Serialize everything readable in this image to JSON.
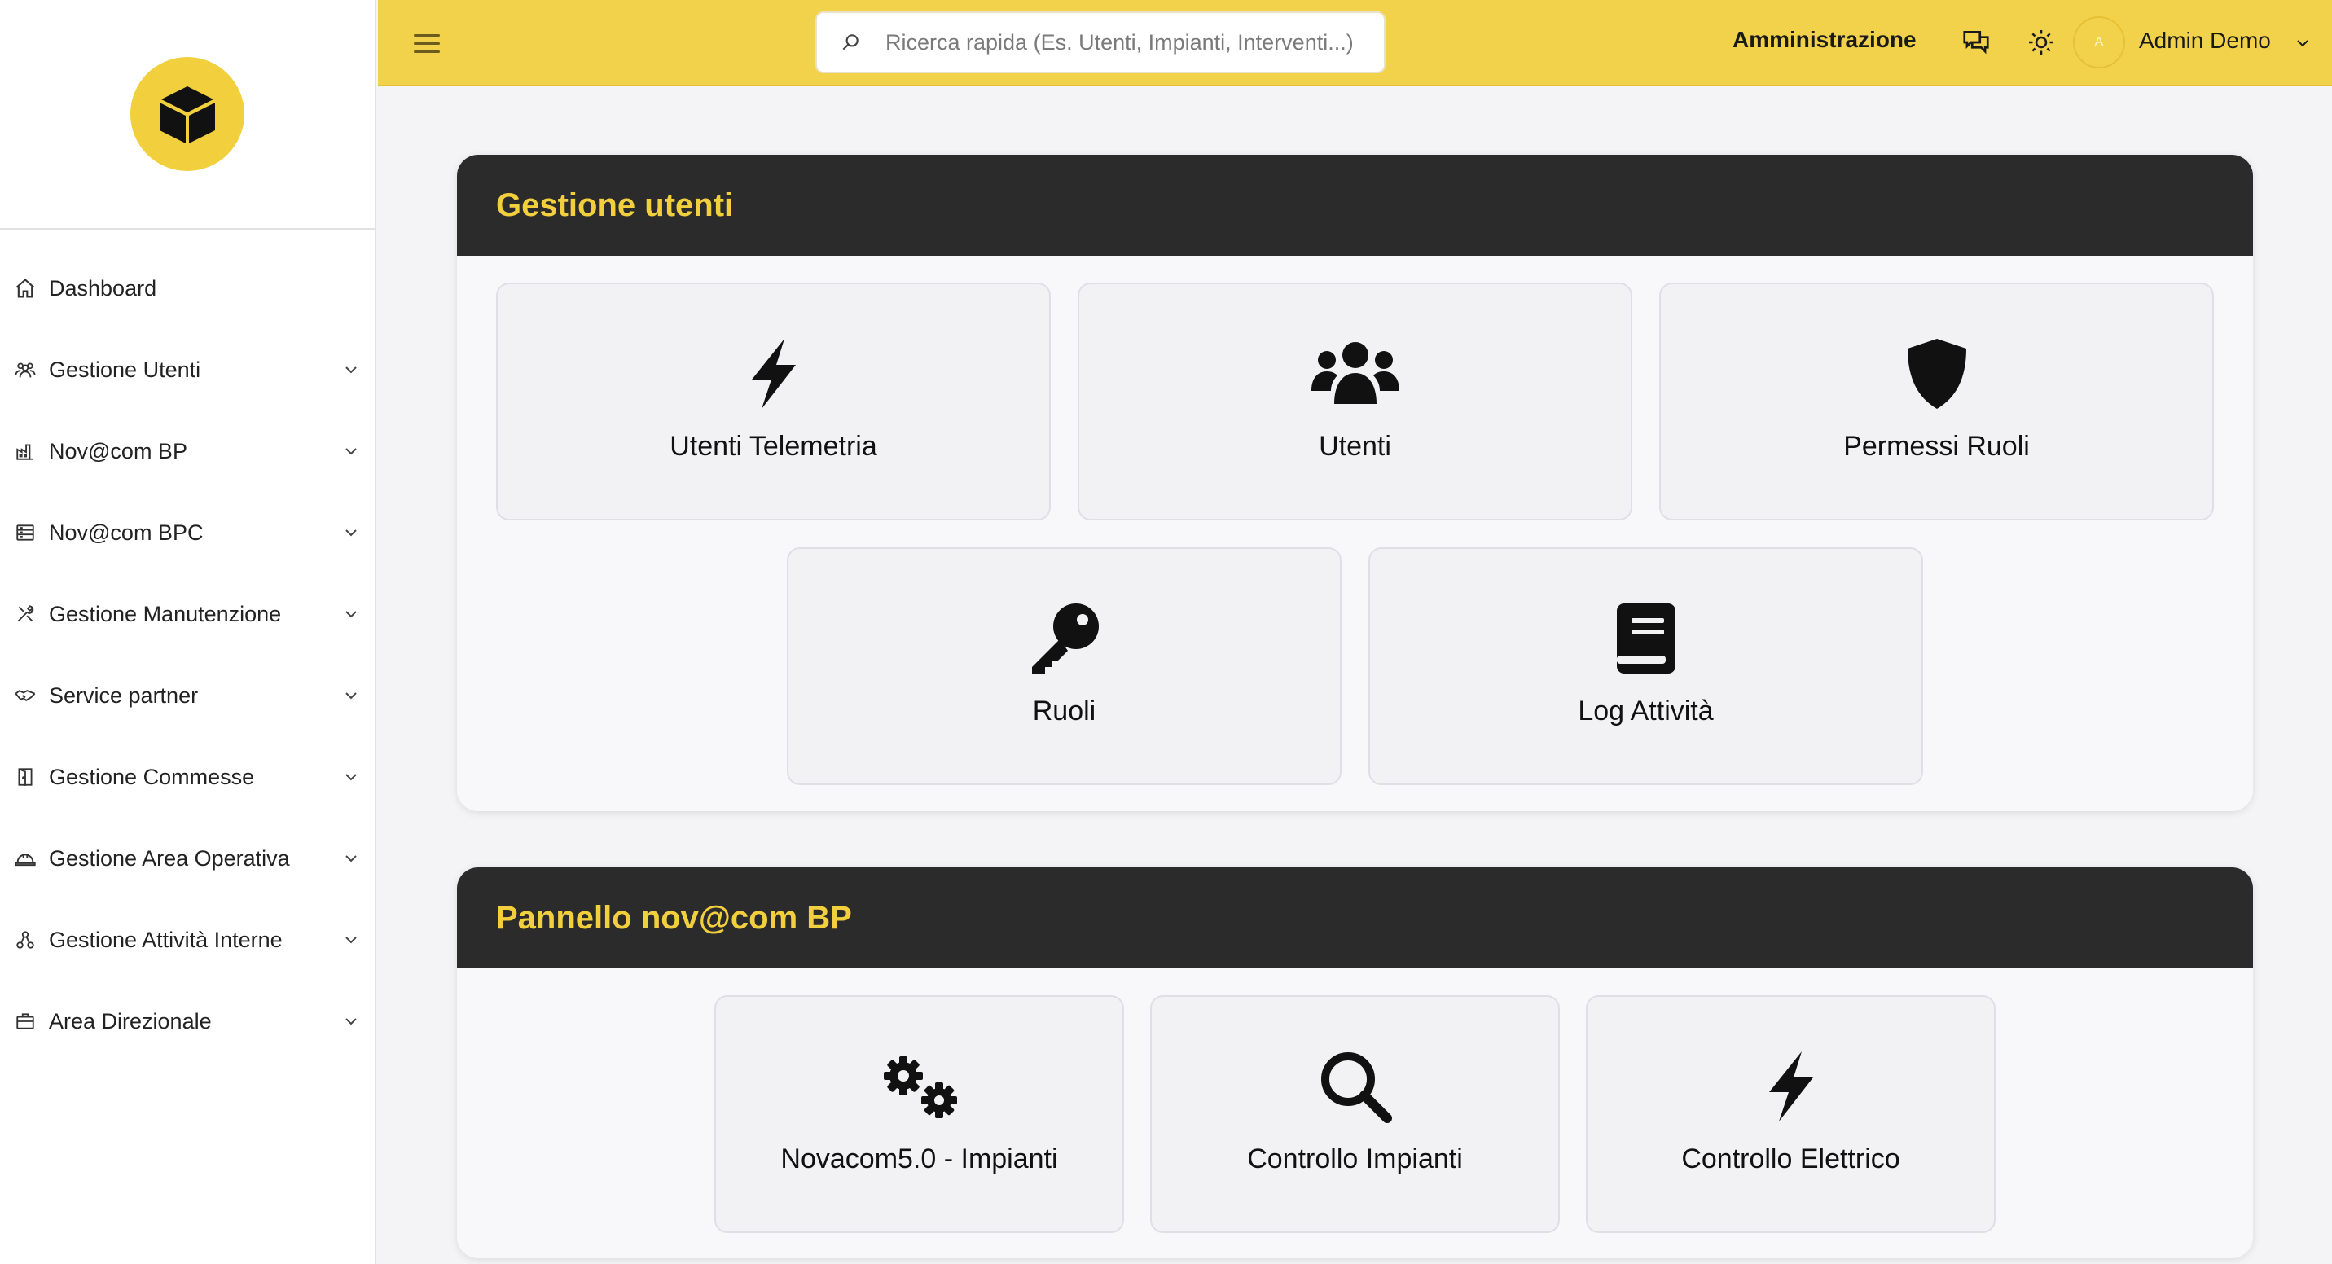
{
  "brand": {
    "logo_icon": "cube-icon",
    "accent_color": "#f2cf3c",
    "dark_color": "#2b2b2b"
  },
  "sidebar": {
    "items": [
      {
        "label": "Dashboard",
        "icon": "home-icon",
        "has_children": false
      },
      {
        "label": "Gestione Utenti",
        "icon": "users-icon",
        "has_children": true
      },
      {
        "label": "Nov@com BP",
        "icon": "factory-icon",
        "has_children": true
      },
      {
        "label": "Nov@com BPC",
        "icon": "server-icon",
        "has_children": true
      },
      {
        "label": "Gestione Manutenzione",
        "icon": "tools-icon",
        "has_children": true
      },
      {
        "label": "Service partner",
        "icon": "handshake-icon",
        "has_children": true
      },
      {
        "label": "Gestione Commesse",
        "icon": "door-icon",
        "has_children": true
      },
      {
        "label": "Gestione Area Operativa",
        "icon": "helmet-icon",
        "has_children": true
      },
      {
        "label": "Gestione Attività Interne",
        "icon": "network-icon",
        "has_children": true
      },
      {
        "label": "Area Direzionale",
        "icon": "briefcase-icon",
        "has_children": true
      }
    ]
  },
  "topbar": {
    "search_placeholder": "Ricerca rapida (Es. Utenti, Impianti, Interventi...)",
    "admin_label": "Amministrazione",
    "avatar_initial": "A",
    "user_name": "Admin Demo"
  },
  "panels": [
    {
      "title": "Gestione utenti",
      "cards": [
        {
          "label": "Utenti Telemetria",
          "icon": "bolt-icon"
        },
        {
          "label": "Utenti",
          "icon": "users-group-icon"
        },
        {
          "label": "Permessi Ruoli",
          "icon": "shield-icon"
        },
        {
          "label": "Ruoli",
          "icon": "key-icon"
        },
        {
          "label": "Log Attività",
          "icon": "book-icon"
        }
      ]
    },
    {
      "title": "Pannello nov@com BP",
      "cards": [
        {
          "label": "Novacom5.0 - Impianti",
          "icon": "gears-icon"
        },
        {
          "label": "Controllo Impianti",
          "icon": "magnifier-icon"
        },
        {
          "label": "Controllo Elettrico",
          "icon": "bolt-icon"
        }
      ]
    }
  ]
}
